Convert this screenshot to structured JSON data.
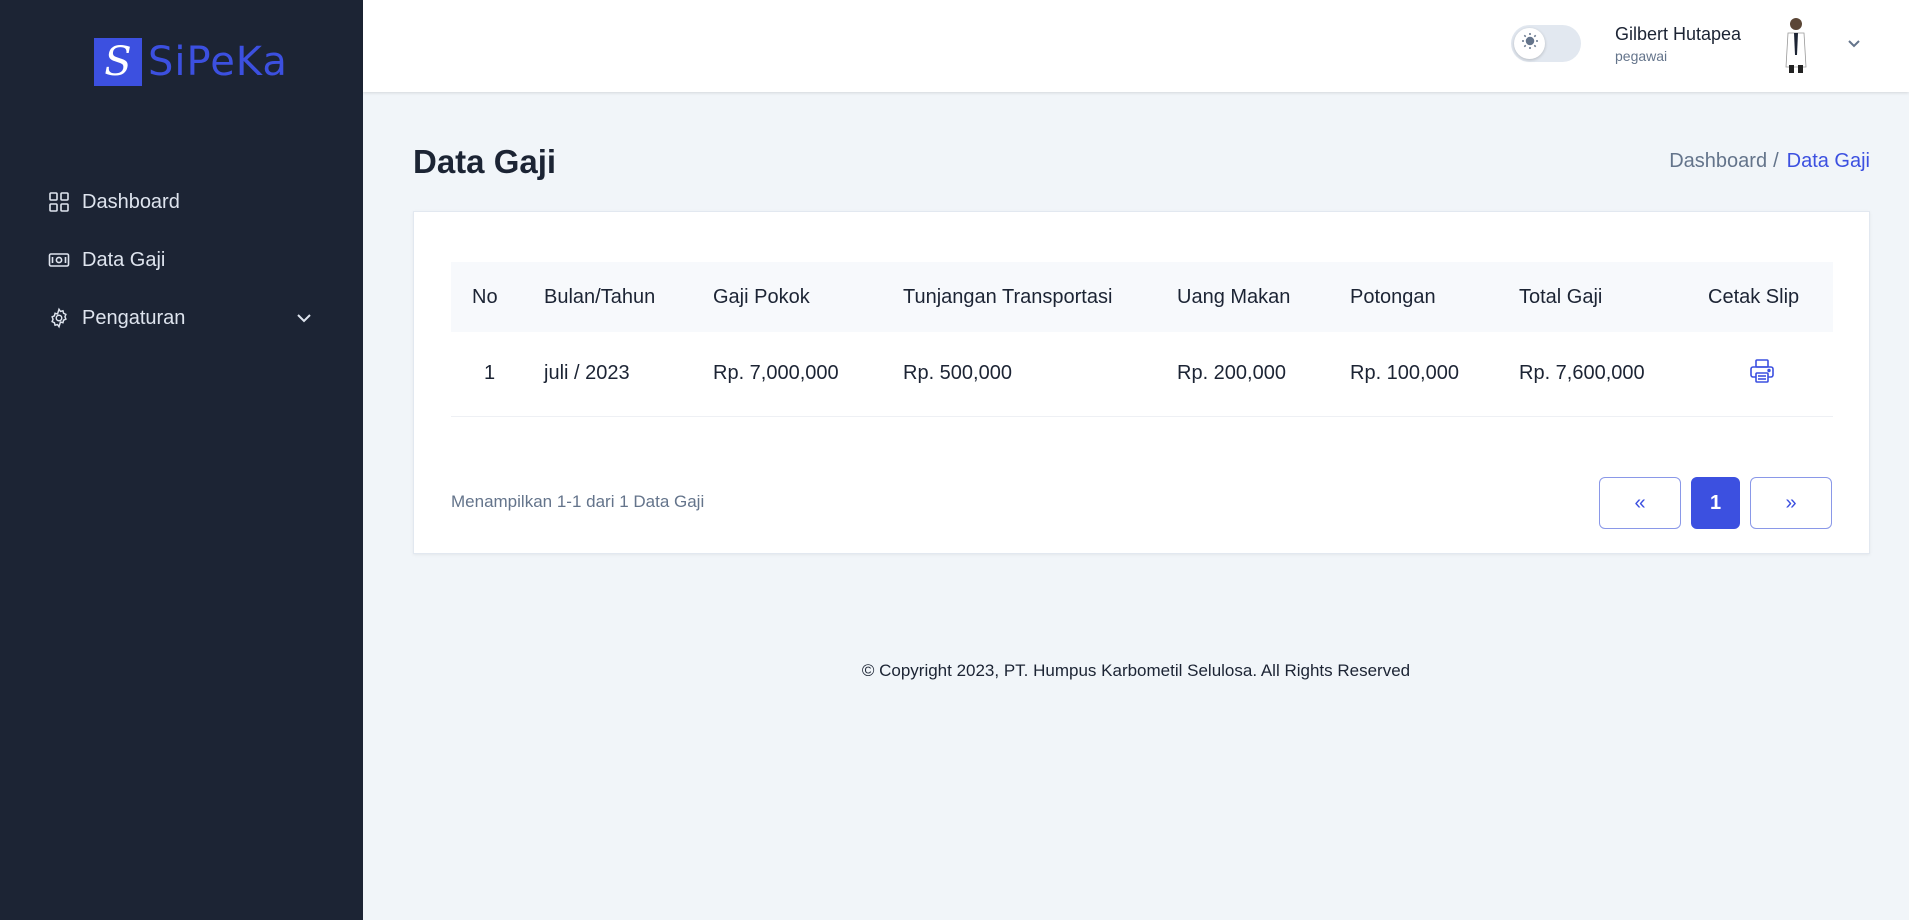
{
  "brand": {
    "mark": "S",
    "name": "SiPeKa",
    "accent": "#3c50e0"
  },
  "sidebar": {
    "items": [
      {
        "label": "Dashboard",
        "icon": "dashboard-icon"
      },
      {
        "label": "Data Gaji",
        "icon": "money-icon"
      },
      {
        "label": "Pengaturan",
        "icon": "gear-icon",
        "expandable": true
      }
    ]
  },
  "header": {
    "theme_toggle": "light",
    "user_name": "Gilbert Hutapea",
    "user_role": "pegawai"
  },
  "page": {
    "title": "Data Gaji",
    "breadcrumb": {
      "parent": "Dashboard",
      "separator": "/",
      "current": "Data Gaji"
    }
  },
  "table": {
    "columns": [
      "No",
      "Bulan/Tahun",
      "Gaji Pokok",
      "Tunjangan Transportasi",
      "Uang Makan",
      "Potongan",
      "Total Gaji",
      "Cetak Slip"
    ],
    "rows": [
      {
        "no": "1",
        "bulan": "juli / 2023",
        "pokok": "Rp. 7,000,000",
        "tunjangan": "Rp. 500,000",
        "makan": "Rp. 200,000",
        "potongan": "Rp. 100,000",
        "total": "Rp. 7,600,000",
        "cetak_icon": "printer-icon"
      }
    ]
  },
  "pagination": {
    "summary": "Menampilkan 1-1 dari 1 Data Gaji",
    "prev": "«",
    "current": "1",
    "next": "»"
  },
  "footer": {
    "text": "© Copyright 2023, PT. Humpus Karbometil Selulosa. All Rights Reserved"
  }
}
